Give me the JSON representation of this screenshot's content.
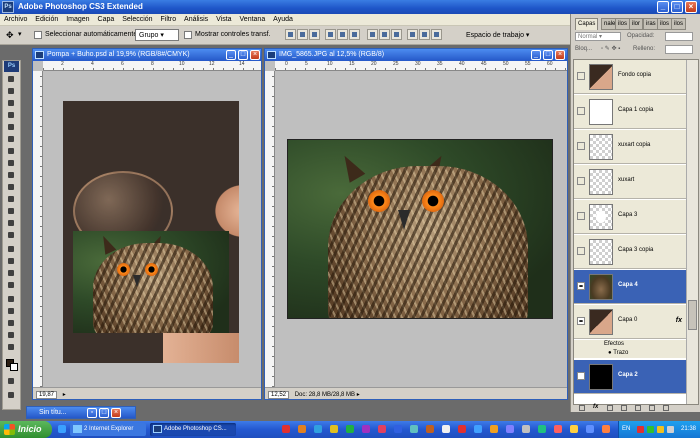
{
  "window": {
    "title": "Adobe Photoshop CS3 Extended",
    "logo": "Ps"
  },
  "menu": [
    "Archivo",
    "Edición",
    "Imagen",
    "Capa",
    "Selección",
    "Filtro",
    "Análisis",
    "Vista",
    "Ventana",
    "Ayuda"
  ],
  "options": {
    "auto_select_label": "Seleccionar automáticamente:",
    "auto_select_value": "Grupo",
    "transform_label": "Mostrar controles transf.",
    "workspace_label": "Espacio de trabajo"
  },
  "toolbox": {
    "logo": "Ps",
    "foreground_color": "#2b1e14",
    "background_color": "#ffffff"
  },
  "doc1": {
    "title": "Pompa + Buho.psd al 19,9% (RGB/8#/CMYK)",
    "zoom": "19,87",
    "ruler_ticks": [
      "2",
      "4",
      "6",
      "8",
      "10",
      "12",
      "14"
    ]
  },
  "doc2": {
    "title": "IMG_5865.JPG al 12,5% (RGB/8)",
    "zoom": "12,52",
    "status": "Doc: 28,8 MB/28,8 MB",
    "ruler_ticks": [
      "0",
      "5",
      "10",
      "15",
      "20",
      "25",
      "30",
      "35",
      "40",
      "45",
      "50",
      "55",
      "60"
    ]
  },
  "layers_panel": {
    "tabs": [
      "Capas",
      "nales",
      "ilos",
      "ilor",
      "iras",
      "ilos",
      "ilos"
    ],
    "blend_mode_prefix": "Bloq...",
    "blend_mode": "Normal",
    "opacity_label": "Opacidad:",
    "fill_label": "Relleno:",
    "effects_label": "Efectos",
    "stroke_label": "Trazo",
    "layers": [
      {
        "name": "Fondo copia",
        "thumb": "face",
        "visible": false,
        "selected": false,
        "fx": ""
      },
      {
        "name": "Capa 1 copia",
        "thumb": "white",
        "visible": false,
        "selected": false,
        "fx": ""
      },
      {
        "name": "xuxart copia",
        "thumb": "trans",
        "visible": false,
        "selected": false,
        "fx": ""
      },
      {
        "name": "xuxart",
        "thumb": "trans",
        "visible": false,
        "selected": false,
        "fx": ""
      },
      {
        "name": "Capa 3",
        "thumb": "shape",
        "visible": false,
        "selected": false,
        "fx": ""
      },
      {
        "name": "Capa 3 copia",
        "thumb": "trans",
        "visible": false,
        "selected": false,
        "fx": ""
      },
      {
        "name": "Capa 4",
        "thumb": "owl",
        "visible": true,
        "selected": true,
        "fx": ""
      },
      {
        "name": "Capa 0",
        "thumb": "face",
        "visible": true,
        "selected": false,
        "fx": "fx"
      },
      {
        "name": "Capa 2",
        "thumb": "black",
        "visible": false,
        "selected": true,
        "fx": ""
      }
    ],
    "bottom_fx": "fx"
  },
  "minimized": {
    "title": "Sin títu..."
  },
  "taskbar": {
    "start": "Inicio",
    "tasks": [
      "2 Internet Explorer",
      "Adobe Photoshop CS..."
    ],
    "language": "EN",
    "clock": "21:38"
  }
}
